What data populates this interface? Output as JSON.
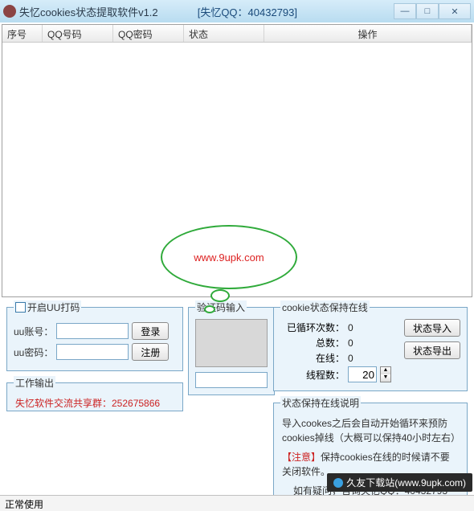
{
  "window": {
    "title": "失忆cookies状态提取软件v1.2",
    "subtitle": "[失忆QQ：40432793]"
  },
  "table": {
    "headers": {
      "col1": "序号",
      "col2": "QQ号码",
      "col3": "QQ密码",
      "col4": "状态",
      "col5": "操作"
    }
  },
  "bubble": {
    "text": "www.9upk.com"
  },
  "uu": {
    "legend": "开启UU打码",
    "account_label": "uu账号：",
    "password_label": "uu密码：",
    "account_value": "",
    "password_value": "",
    "login_btn": "登录",
    "register_btn": "注册"
  },
  "captcha": {
    "legend": "验证码输入",
    "input_value": ""
  },
  "cookie_status": {
    "legend": "cookie状态保持在线",
    "loop_label": "已循环次数：",
    "loop_value": "0",
    "total_label": "总数：",
    "total_value": "0",
    "online_label": "在线：",
    "online_value": "0",
    "threads_label": "线程数：",
    "threads_value": "20",
    "import_btn": "状态导入",
    "export_btn": "状态导出"
  },
  "work_output": {
    "legend": "工作输出",
    "text": "失忆软件交流共享群：252675866"
  },
  "desc": {
    "legend": "状态保持在线说明",
    "line1": "导入cookes之后会自动开始循环来预防cookies掉线（大概可以保持40小时左右）",
    "line2_prefix": "【注意】",
    "line2": "保持cookies在线的时候请不要关闭软件。",
    "line3": "如有疑问，咨询失忆QQ：40432793"
  },
  "statusbar": {
    "text": "正常使用"
  },
  "watermark": {
    "text": "久友下载站(www.9upk.com)"
  }
}
